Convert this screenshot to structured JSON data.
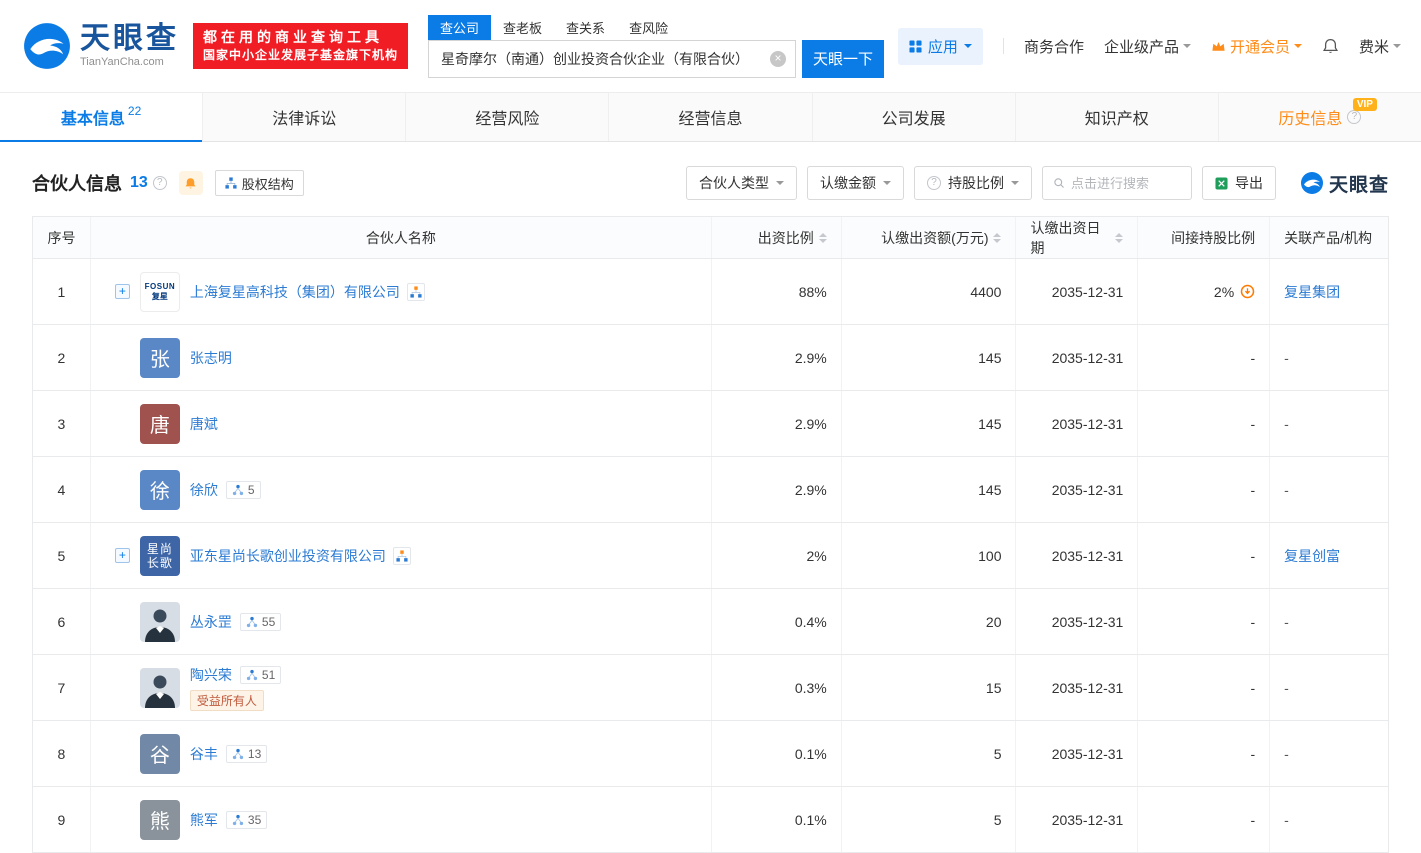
{
  "colors": {
    "brand_blue": "#0b7ce6",
    "link_blue": "#2b7bd3",
    "vip_orange": "#ff8c19",
    "slogan_red": "#f01d25"
  },
  "icons": {
    "logo-swirl-icon": "blue-circle-wave",
    "apps-grid-icon": "four-squares",
    "crown-icon": "crown",
    "bell-icon": "bell",
    "clear-icon": "×",
    "question-icon": "?",
    "equity-structure-icon": "org-chart",
    "graph-icon": "network-nodes",
    "sort-icon": "▲▼",
    "search-icon": "magnifier",
    "export-icon": "green-excel",
    "penetrate-icon": "orange-circle-arrow",
    "plus-icon": "+",
    "caret-down-icon": "▾"
  },
  "header": {
    "logo": {
      "brand": "天眼查",
      "domain": "TianYanCha.com"
    },
    "slogan": {
      "line1": "都在用的商业查询工具",
      "line2": "国家中小企业发展子基金旗下机构"
    },
    "search": {
      "tabs": [
        {
          "label": "查公司",
          "active": true
        },
        {
          "label": "查老板",
          "active": false
        },
        {
          "label": "查关系",
          "active": false
        },
        {
          "label": "查风险",
          "active": false
        }
      ],
      "value": "星奇摩尔（南通）创业投资合伙企业（有限合伙）",
      "button": "天眼一下"
    },
    "nav": {
      "apps": "应用",
      "cooperation": "商务合作",
      "enterprise": "企业级产品",
      "vip": "开通会员",
      "user": "费米"
    }
  },
  "tabs": [
    {
      "label": "基本信息",
      "count": "22",
      "active": true,
      "vip": ""
    },
    {
      "label": "法律诉讼",
      "count": "",
      "active": false,
      "vip": ""
    },
    {
      "label": "经营风险",
      "count": "",
      "active": false,
      "vip": ""
    },
    {
      "label": "经营信息",
      "count": "",
      "active": false,
      "vip": ""
    },
    {
      "label": "公司发展",
      "count": "",
      "active": false,
      "vip": ""
    },
    {
      "label": "知识产权",
      "count": "",
      "active": false,
      "vip": ""
    },
    {
      "label": "历史信息",
      "count": "",
      "active": false,
      "vip": "VIP"
    }
  ],
  "section": {
    "title": "合伙人信息",
    "count": "13",
    "equity_structure": "股权结构",
    "filter_type": "合伙人类型",
    "filter_amount": "认缴金额",
    "filter_ratio": "持股比例",
    "search_placeholder": "点击进行搜索",
    "export": "导出",
    "brand": "天眼查"
  },
  "table": {
    "headers": [
      {
        "label": "序号",
        "sortable": false
      },
      {
        "label": "合伙人名称",
        "sortable": false
      },
      {
        "label": "出资比例",
        "sortable": true
      },
      {
        "label": "认缴出资额(万元)",
        "sortable": true
      },
      {
        "label": "认缴出资日期",
        "sortable": true
      },
      {
        "label": "间接持股比例",
        "sortable": false
      },
      {
        "label": "关联产品/机构",
        "sortable": false
      }
    ],
    "rows": [
      {
        "no": "1",
        "expand": true,
        "avatar": {
          "type": "logo",
          "lines": [
            "FOSUN",
            "复星"
          ],
          "color": "#00387d"
        },
        "name": "上海复星高科技（集团）有限公司",
        "equity": true,
        "graph": "",
        "tag": "",
        "ratio": "88%",
        "amount": "4400",
        "date": "2035-12-31",
        "indirect": "2%",
        "indirect_icon": true,
        "related": "复星集团",
        "related_link": true
      },
      {
        "no": "2",
        "expand": false,
        "avatar": {
          "type": "initial",
          "text": "张",
          "bg": "#5a87c5"
        },
        "name": "张志明",
        "equity": false,
        "graph": "",
        "tag": "",
        "ratio": "2.9%",
        "amount": "145",
        "date": "2035-12-31",
        "indirect": "-",
        "indirect_icon": false,
        "related": "-",
        "related_link": false
      },
      {
        "no": "3",
        "expand": false,
        "avatar": {
          "type": "initial",
          "text": "唐",
          "bg": "#a0524f"
        },
        "name": "唐斌",
        "equity": false,
        "graph": "",
        "tag": "",
        "ratio": "2.9%",
        "amount": "145",
        "date": "2035-12-31",
        "indirect": "-",
        "indirect_icon": false,
        "related": "-",
        "related_link": false
      },
      {
        "no": "4",
        "expand": false,
        "avatar": {
          "type": "initial",
          "text": "徐",
          "bg": "#5a87c5"
        },
        "name": "徐欣",
        "equity": false,
        "graph": "5",
        "tag": "",
        "ratio": "2.9%",
        "amount": "145",
        "date": "2035-12-31",
        "indirect": "-",
        "indirect_icon": false,
        "related": "-",
        "related_link": false
      },
      {
        "no": "5",
        "expand": true,
        "avatar": {
          "type": "initial2",
          "lines": [
            "星尚",
            "长歌"
          ],
          "bg": "#3e66a7"
        },
        "name": "亚东星尚长歌创业投资有限公司",
        "equity": true,
        "graph": "",
        "tag": "",
        "ratio": "2%",
        "amount": "100",
        "date": "2035-12-31",
        "indirect": "-",
        "indirect_icon": false,
        "related": "复星创富",
        "related_link": true
      },
      {
        "no": "6",
        "expand": false,
        "avatar": {
          "type": "photo"
        },
        "name": "丛永罡",
        "equity": false,
        "graph": "55",
        "tag": "",
        "ratio": "0.4%",
        "amount": "20",
        "date": "2035-12-31",
        "indirect": "-",
        "indirect_icon": false,
        "related": "-",
        "related_link": false
      },
      {
        "no": "7",
        "expand": false,
        "avatar": {
          "type": "photo"
        },
        "name": "陶兴荣",
        "equity": false,
        "graph": "51",
        "tag": "受益所有人",
        "ratio": "0.3%",
        "amount": "15",
        "date": "2035-12-31",
        "indirect": "-",
        "indirect_icon": false,
        "related": "-",
        "related_link": false
      },
      {
        "no": "8",
        "expand": false,
        "avatar": {
          "type": "initial",
          "text": "谷",
          "bg": "#7189a6"
        },
        "name": "谷丰",
        "equity": false,
        "graph": "13",
        "tag": "",
        "ratio": "0.1%",
        "amount": "5",
        "date": "2035-12-31",
        "indirect": "-",
        "indirect_icon": false,
        "related": "-",
        "related_link": false
      },
      {
        "no": "9",
        "expand": false,
        "avatar": {
          "type": "initial",
          "text": "熊",
          "bg": "#8a939c"
        },
        "name": "熊军",
        "equity": false,
        "graph": "35",
        "tag": "",
        "ratio": "0.1%",
        "amount": "5",
        "date": "2035-12-31",
        "indirect": "-",
        "indirect_icon": false,
        "related": "-",
        "related_link": false
      }
    ]
  }
}
